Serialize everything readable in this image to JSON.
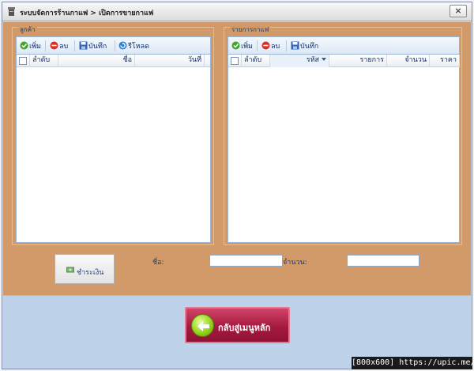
{
  "window": {
    "title": "ระบบจัดการร้านกาแฟ > เปิดการขายกาแฟ",
    "close_label": "×"
  },
  "customers": {
    "group_label": "ลูกค้า",
    "toolbar": {
      "add": "เพิ่ม",
      "delete": "ลบ",
      "save": "บันทึก",
      "reload": "รีโหลด"
    },
    "columns": [
      "ลำดับ",
      "ชื่อ",
      "วันที่"
    ],
    "rows": []
  },
  "coffee_items": {
    "group_label": "รายการกาแฟ",
    "toolbar": {
      "add": "เพิ่ม",
      "delete": "ลบ",
      "save": "บันทึก"
    },
    "columns": [
      "ลำดับ",
      "รหัส",
      "รายการ",
      "จำนวน",
      "ราคา"
    ],
    "sorted_column": "รหัส",
    "rows": []
  },
  "footer": {
    "pay_button": "ชำระเงิน",
    "name_label": "ชื่อ:",
    "name_value": "",
    "quantity_label": "จำนวน:",
    "quantity_value": ""
  },
  "back_button": "กลับสู่เมนูหลัก",
  "watermark": "[800x600] https://upic.me/",
  "colors": {
    "panel_bg": "#d19a68",
    "bottom_bg": "#bed3ea",
    "back_button": "#b3244b"
  }
}
